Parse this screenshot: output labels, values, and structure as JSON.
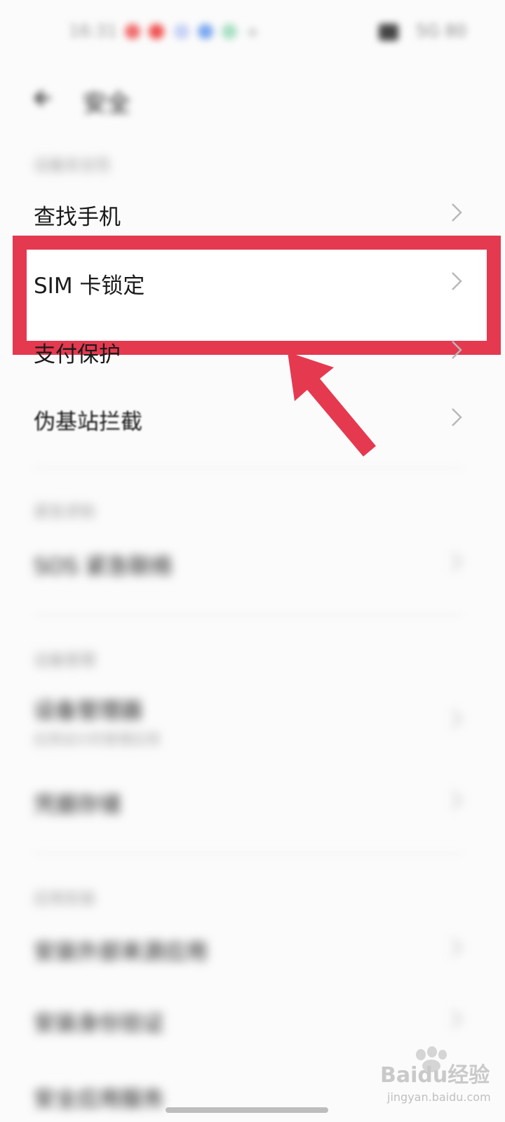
{
  "status_bar": {
    "time": "16:31",
    "right_text": "5G 80"
  },
  "header": {
    "back_icon": "back-arrow-icon",
    "title": "安全"
  },
  "sections": [
    {
      "label": "设备安全性",
      "items": [
        {
          "label": "查找手机"
        },
        {
          "label": "SIM 卡锁定"
        },
        {
          "label": "支付保护"
        },
        {
          "label": "伪基站拦截"
        }
      ]
    },
    {
      "label": "紧急求助",
      "items": [
        {
          "label": "SOS 紧急联络"
        }
      ]
    },
    {
      "label": "设备管理",
      "items": [
        {
          "label": "设备管理器",
          "sub": "应用设计的管理应用"
        },
        {
          "label": "凭据存储"
        }
      ]
    },
    {
      "label": "应用安装",
      "items": [
        {
          "label": "安装外部来源应用"
        },
        {
          "label": "安装身份验证"
        },
        {
          "label": "安全应用服务"
        }
      ]
    }
  ],
  "annotation": {
    "color": "#e53950",
    "highlighted_item": "SIM 卡锁定"
  },
  "watermark": {
    "logo": "baidu-paw-icon",
    "text": "Baidu经验",
    "url": "jingyan.baidu.com"
  }
}
